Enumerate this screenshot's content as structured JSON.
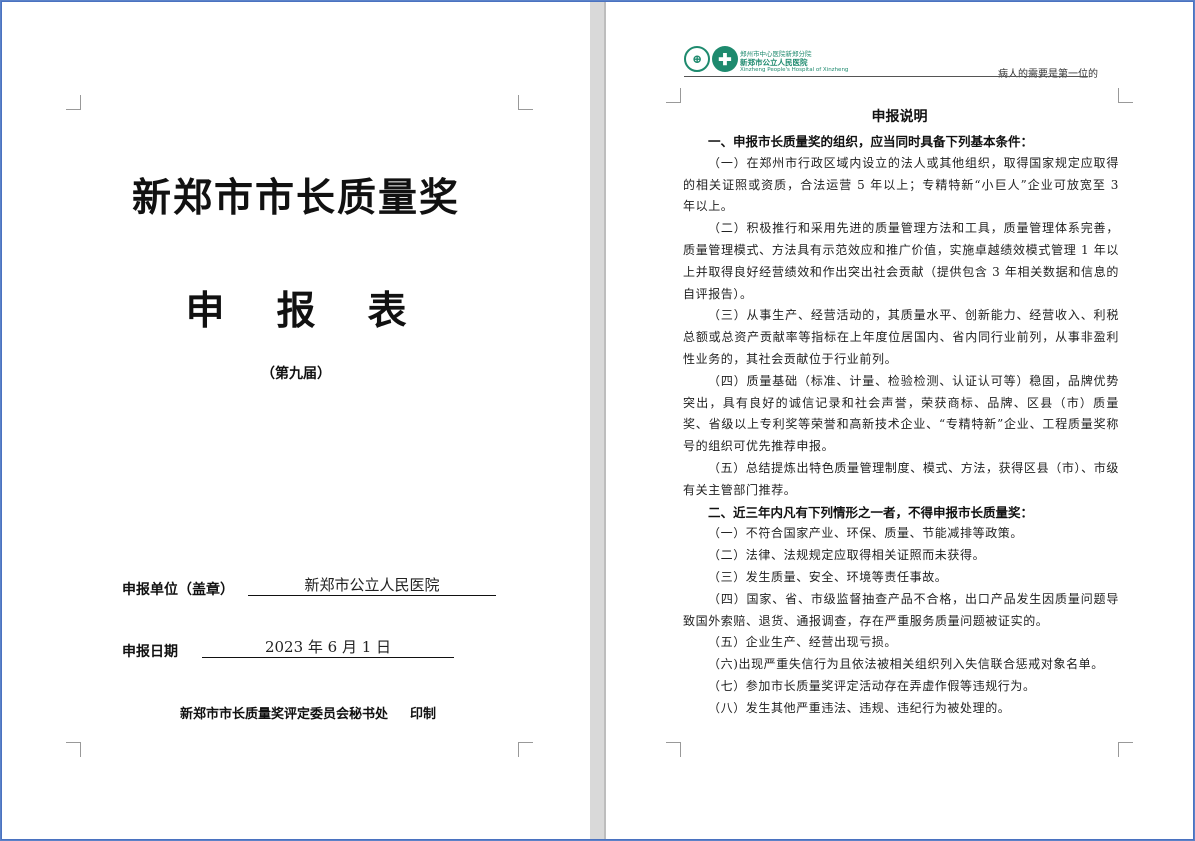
{
  "cover": {
    "title": "新郑市市长质量奖",
    "form_chars": [
      "申",
      "报",
      "表"
    ],
    "edition": "（第九届）",
    "unit_label": "申报单位（盖章）",
    "unit_value": "新郑市公立人民医院",
    "date_label": "申报日期",
    "date_value": "2023 年 6 月 1 日",
    "printer_org": "新郑市市长质量奖评定委员会秘书处",
    "printer_action": "印制"
  },
  "header": {
    "logo_left_glyph": "⊕",
    "logo_right_glyph": "✚",
    "line1": "郑州市中心医院新郑分院",
    "line2": "新郑市公立人民医院",
    "line3": "Xinzheng People's Hospital of Xinzheng",
    "slogan": "病人的需要是第一位的"
  },
  "instructions": {
    "title": "申报说明",
    "section1_heading": "一、申报市长质量奖的组织，应当同时具备下列基本条件：",
    "section1_items": [
      "（一）在郑州市行政区域内设立的法人或其他组织，取得国家规定应取得的相关证照或资质，合法运营 5 年以上；专精特新“小巨人”企业可放宽至 3 年以上。",
      "（二）积极推行和采用先进的质量管理方法和工具，质量管理体系完善，质量管理模式、方法具有示范效应和推广价值，实施卓越绩效模式管理 1 年以上并取得良好经营绩效和作出突出社会贡献（提供包含 3 年相关数据和信息的自评报告）。",
      "（三）从事生产、经营活动的，其质量水平、创新能力、经营收入、利税总额或总资产贡献率等指标在上年度位居国内、省内同行业前列，从事非盈利性业务的，其社会贡献位于行业前列。",
      "（四）质量基础（标准、计量、检验检测、认证认可等）稳固，品牌优势突出，具有良好的诚信记录和社会声誉，荣获商标、品牌、区县（市）质量奖、省级以上专利奖等荣誉和高新技术企业、“专精特新”企业、工程质量奖称号的组织可优先推荐申报。",
      "（五）总结提炼出特色质量管理制度、模式、方法，获得区县（市）、市级有关主管部门推荐。"
    ],
    "section2_heading": "二、近三年内凡有下列情形之一者，不得申报市长质量奖：",
    "section2_items": [
      "（一）不符合国家产业、环保、质量、节能减排等政策。",
      "（二）法律、法规规定应取得相关证照而未获得。",
      "（三）发生质量、安全、环境等责任事故。",
      "（四）国家、省、市级监督抽查产品不合格，出口产品发生因质量问题导致国外索赔、退货、通报调查，存在严重服务质量问题被证实的。",
      "（五）企业生产、经营出现亏损。",
      "（六)出现严重失信行为且依法被相关组织列入失信联合惩戒对象名单。",
      "（七）参加市长质量奖评定活动存在弄虚作假等违规行为。",
      "（八）发生其他严重违法、违规、违纪行为被处理的。"
    ]
  }
}
